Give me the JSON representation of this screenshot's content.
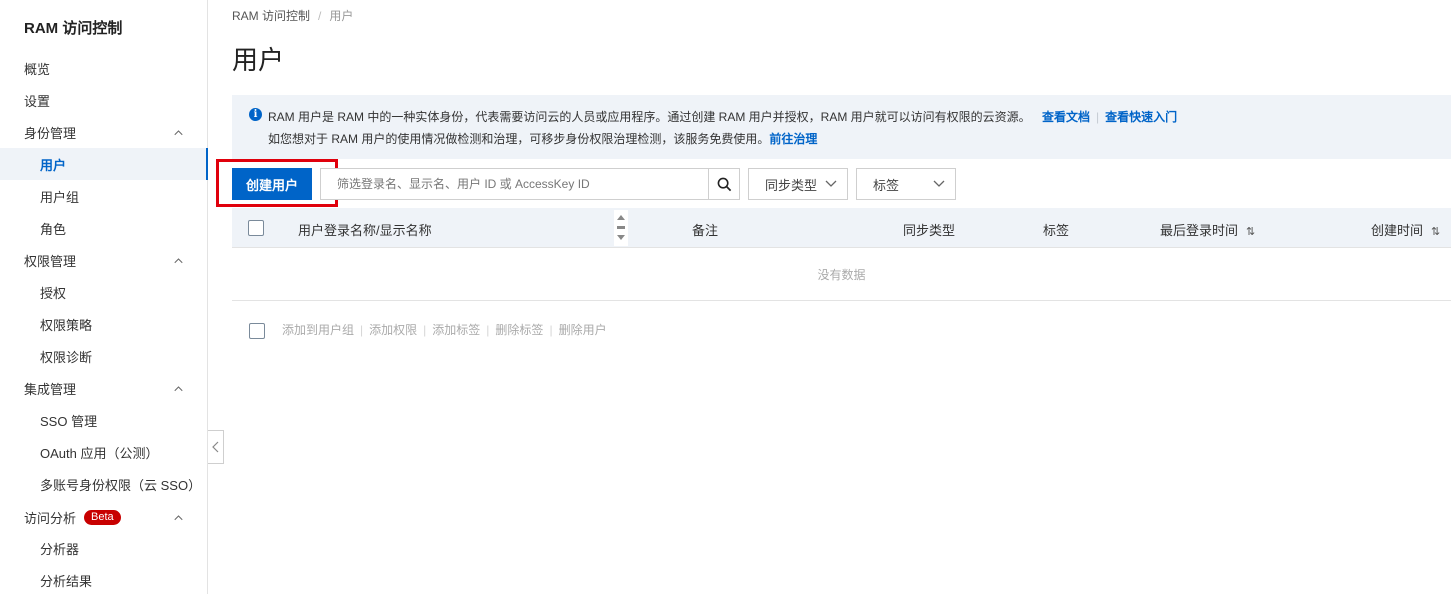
{
  "sidebar": {
    "title": "RAM 访问控制",
    "items": [
      {
        "label": "概览"
      },
      {
        "label": "设置"
      },
      {
        "label": "身份管理"
      },
      {
        "label": "用户"
      },
      {
        "label": "用户组"
      },
      {
        "label": "角色"
      },
      {
        "label": "权限管理"
      },
      {
        "label": "授权"
      },
      {
        "label": "权限策略"
      },
      {
        "label": "权限诊断"
      },
      {
        "label": "集成管理"
      },
      {
        "label": "SSO 管理"
      },
      {
        "label": "OAuth 应用（公测）"
      },
      {
        "label": "多账号身份权限（云 SSO）"
      },
      {
        "label": "访问分析"
      },
      {
        "label": "分析器"
      },
      {
        "label": "分析结果"
      }
    ],
    "beta_badge": "Beta"
  },
  "breadcrumb": {
    "root": "RAM 访问控制",
    "sep": "/",
    "current": "用户"
  },
  "page": {
    "title": "用户"
  },
  "info": {
    "line1": "RAM 用户是 RAM 中的一种实体身份，代表需要访问云的人员或应用程序。通过创建 RAM 用户并授权，RAM 用户就可以访问有权限的云资源。",
    "link_docs": "查看文档",
    "sep": "|",
    "link_quickstart": "查看快速入门",
    "line2": "如您想对于 RAM 用户的使用情况做检测和治理，可移步身份权限治理检测，该服务免费使用。",
    "link_govern": "前往治理"
  },
  "toolbar": {
    "create_label": "创建用户",
    "search_placeholder": "筛选登录名、显示名、用户 ID 或 AccessKey ID",
    "sync_select": "同步类型",
    "tag_select": "标签"
  },
  "table": {
    "columns": [
      "用户登录名称/显示名称",
      "备注",
      "同步类型",
      "标签",
      "最后登录时间",
      "创建时间"
    ],
    "sort_glyph": "⇅",
    "empty_text": "没有数据"
  },
  "batch": {
    "actions": [
      "添加到用户组",
      "添加权限",
      "添加标签",
      "删除标签",
      "删除用户"
    ],
    "sep": "|"
  },
  "colors": {
    "accent": "#0064c8",
    "highlight": "#e0000c",
    "beta": "#c80000",
    "header_bg": "#eff3f8"
  }
}
